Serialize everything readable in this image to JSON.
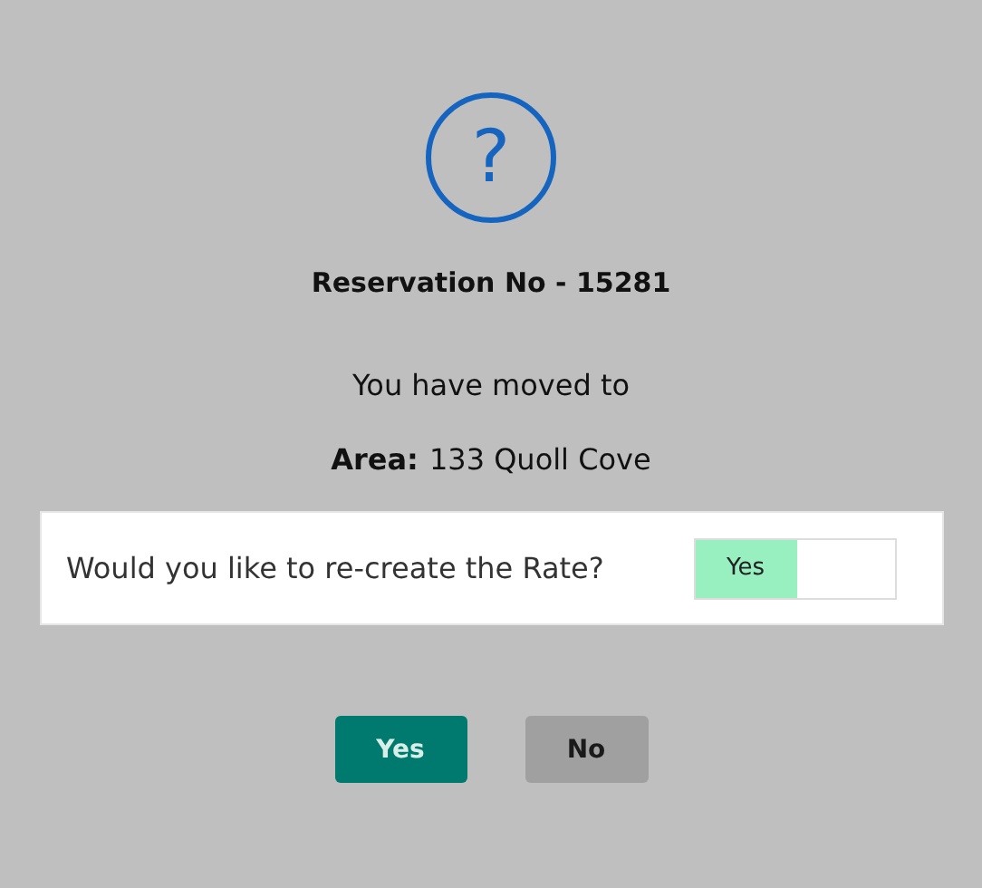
{
  "dialog": {
    "icon_glyph": "?",
    "title": "Reservation No - 15281",
    "message": "You have moved to",
    "area_label": "Area:",
    "area_value": "133 Quoll Cove"
  },
  "question": {
    "text": "Would you like to re-create the Rate?",
    "toggle": {
      "label": "Yes",
      "on": true
    }
  },
  "buttons": [
    {
      "label": "Yes",
      "kind": "primary"
    },
    {
      "label": "No",
      "kind": "secondary"
    }
  ]
}
